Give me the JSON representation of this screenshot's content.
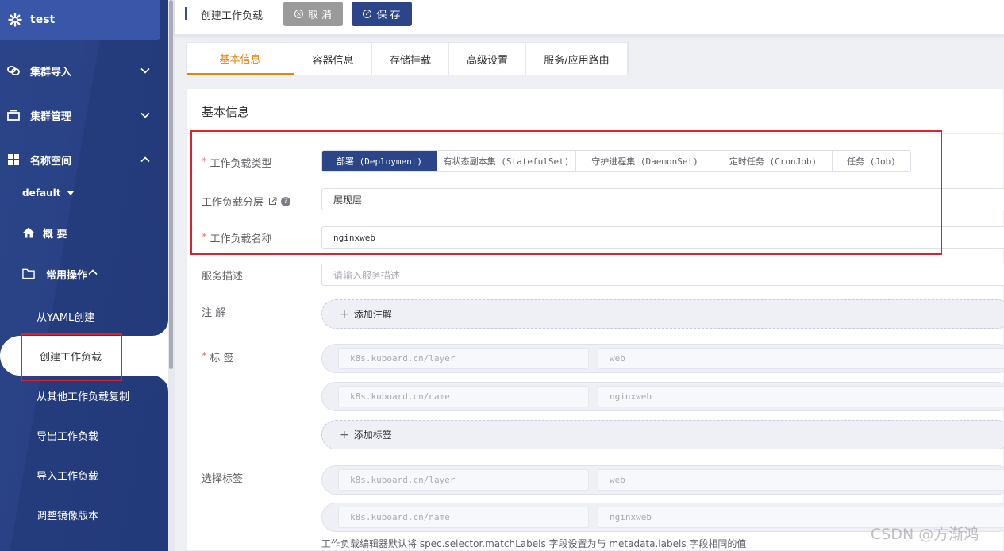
{
  "sidebar": {
    "app_title": "test",
    "menu": {
      "cluster_import": "集群导入",
      "cluster_manage": "集群管理",
      "namespace": "名称空间"
    },
    "namespace_selected": "default",
    "overview": "概 要",
    "common_ops": "常用操作",
    "leaves": {
      "from_yaml": "从YAML创建",
      "create_workload": "创建工作负载",
      "copy_workload": "从其他工作负载复制",
      "export_workload": "导出工作负载",
      "import_workload": "导入工作负载",
      "adjust_image": "调整镜像版本"
    }
  },
  "topbar": {
    "title": "创建工作负载",
    "cancel_label": "取 消",
    "save_label": "保 存"
  },
  "tabs": [
    "基本信息",
    "容器信息",
    "存储挂载",
    "高级设置",
    "服务/应用路由"
  ],
  "form": {
    "section_title": "基本信息",
    "workload_type_label": "工作负载类型",
    "workload_types": [
      "部署 (Deployment)",
      "有状态副本集 (StatefulSet)",
      "守护进程集 (DaemonSet)",
      "定时任务 (CronJob)",
      "任务 (Job)"
    ],
    "layer_label": "工作负载分层",
    "layer_value": "展现层",
    "name_label": "工作负载名称",
    "name_value": "nginxweb",
    "desc_label": "服务描述",
    "desc_placeholder": "请输入服务描述",
    "annotation_label": "注 解",
    "add_annotation": "添加注解",
    "labels_label": "标 签",
    "labels": [
      {
        "key": "k8s.kuboard.cn/layer",
        "value": "web"
      },
      {
        "key": "k8s.kuboard.cn/name",
        "value": "nginxweb"
      }
    ],
    "add_label": "添加标签",
    "selector_label": "选择标签",
    "selectors": [
      {
        "key": "k8s.kuboard.cn/layer",
        "value": "web"
      },
      {
        "key": "k8s.kuboard.cn/name",
        "value": "nginxweb"
      }
    ],
    "selector_hint": "工作负载编辑器默认将 spec.selector.matchLabels 字段设置为与 metadata.labels 字段相同的值"
  },
  "watermark": "CSDN @方渐鸿",
  "colors": {
    "sidebar": "#283f80",
    "primary": "#2c4589",
    "tab_active": "#e6830f",
    "highlight": "#d9232e"
  }
}
